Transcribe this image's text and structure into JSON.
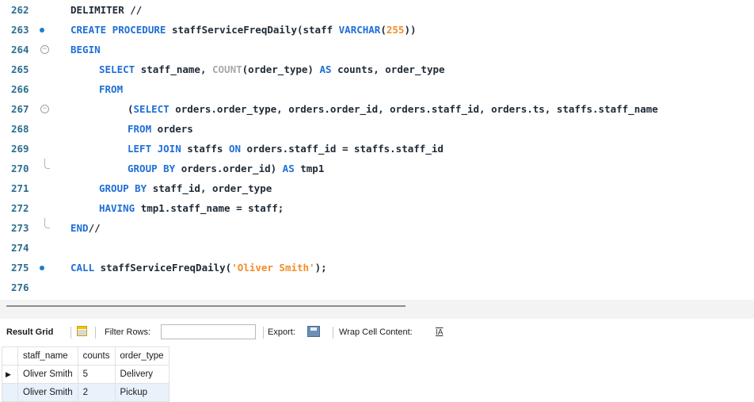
{
  "editor": {
    "lines": [
      {
        "n": "262",
        "marker": "",
        "segments": [
          {
            "t": "DELIMITER //",
            "c": ""
          }
        ],
        "indent": 0
      },
      {
        "n": "263",
        "marker": "dot",
        "segments": [
          {
            "t": "CREATE PROCEDURE ",
            "c": "kw"
          },
          {
            "t": "staffServiceFreqDaily(staff ",
            "c": ""
          },
          {
            "t": "VARCHAR",
            "c": "kw"
          },
          {
            "t": "(",
            "c": ""
          },
          {
            "t": "255",
            "c": "num"
          },
          {
            "t": "))",
            "c": ""
          }
        ],
        "indent": 0
      },
      {
        "n": "264",
        "marker": "fold",
        "segments": [
          {
            "t": "BEGIN",
            "c": "kw"
          }
        ],
        "indent": 0
      },
      {
        "n": "265",
        "marker": "",
        "segments": [
          {
            "t": "SELECT ",
            "c": "kw"
          },
          {
            "t": "staff_name, ",
            "c": ""
          },
          {
            "t": "COUNT",
            "c": "fn"
          },
          {
            "t": "(order_type) ",
            "c": ""
          },
          {
            "t": "AS ",
            "c": "kw"
          },
          {
            "t": "counts, order_type",
            "c": ""
          }
        ],
        "indent": 4
      },
      {
        "n": "266",
        "marker": "",
        "segments": [
          {
            "t": "FROM",
            "c": "kw"
          }
        ],
        "indent": 4
      },
      {
        "n": "267",
        "marker": "fold",
        "segments": [
          {
            "t": "(",
            "c": ""
          },
          {
            "t": "SELECT ",
            "c": "kw"
          },
          {
            "t": "orders.order_type, orders.order_id, orders.staff_id, orders.ts, staffs.staff_name",
            "c": ""
          }
        ],
        "indent": 8
      },
      {
        "n": "268",
        "marker": "",
        "segments": [
          {
            "t": "FROM ",
            "c": "kw"
          },
          {
            "t": "orders",
            "c": ""
          }
        ],
        "indent": 8
      },
      {
        "n": "269",
        "marker": "",
        "segments": [
          {
            "t": "LEFT JOIN ",
            "c": "kw"
          },
          {
            "t": "staffs ",
            "c": ""
          },
          {
            "t": "ON ",
            "c": "kw"
          },
          {
            "t": "orders.staff_id = staffs.staff_id",
            "c": ""
          }
        ],
        "indent": 8
      },
      {
        "n": "270",
        "marker": "foldend",
        "segments": [
          {
            "t": "GROUP BY ",
            "c": "kw"
          },
          {
            "t": "orders.order_id) ",
            "c": ""
          },
          {
            "t": "AS ",
            "c": "kw"
          },
          {
            "t": "tmp1",
            "c": ""
          }
        ],
        "indent": 8
      },
      {
        "n": "271",
        "marker": "",
        "segments": [
          {
            "t": "GROUP BY ",
            "c": "kw"
          },
          {
            "t": "staff_id, order_type",
            "c": ""
          }
        ],
        "indent": 4
      },
      {
        "n": "272",
        "marker": "",
        "segments": [
          {
            "t": "HAVING ",
            "c": "kw"
          },
          {
            "t": "tmp1.staff_name = staff;",
            "c": ""
          }
        ],
        "indent": 4
      },
      {
        "n": "273",
        "marker": "foldend",
        "segments": [
          {
            "t": "END",
            "c": "kw"
          },
          {
            "t": "//",
            "c": ""
          }
        ],
        "indent": 0
      },
      {
        "n": "274",
        "marker": "",
        "segments": [],
        "indent": 0
      },
      {
        "n": "275",
        "marker": "dot",
        "segments": [
          {
            "t": "CALL ",
            "c": "kw"
          },
          {
            "t": "staffServiceFreqDaily(",
            "c": ""
          },
          {
            "t": "'Oliver Smith'",
            "c": "str"
          },
          {
            "t": ");",
            "c": ""
          }
        ],
        "indent": 0
      },
      {
        "n": "276",
        "marker": "",
        "segments": [],
        "indent": 0
      }
    ]
  },
  "toolbar": {
    "result_grid_label": "Result Grid",
    "grid_icon": "grid-icon",
    "filter_rows_label": "Filter Rows:",
    "filter_rows_value": "",
    "export_label": "Export:",
    "export_icon": "save-icon",
    "wrap_label": "Wrap Cell Content:",
    "wrap_icon": "wrap-text-icon"
  },
  "grid": {
    "columns": [
      "staff_name",
      "counts",
      "order_type"
    ],
    "rows": [
      [
        "Oliver Smith",
        "5",
        "Delivery"
      ],
      [
        "Oliver Smith",
        "2",
        "Pickup"
      ]
    ],
    "current_row_marker": "▶"
  }
}
